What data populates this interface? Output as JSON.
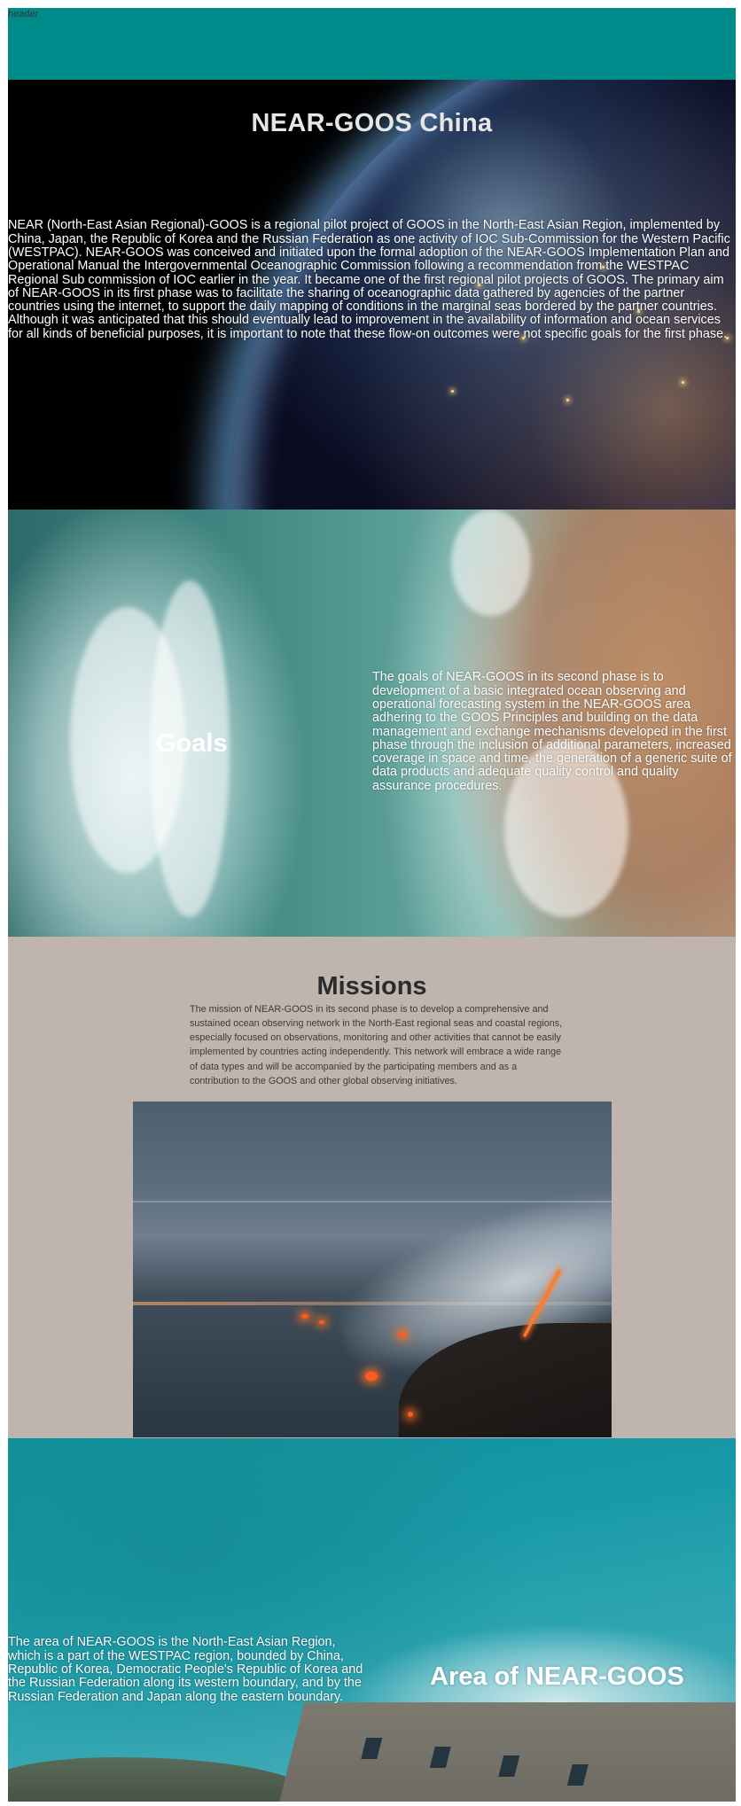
{
  "header": {
    "label": "header",
    "bar_color": "#008b8b"
  },
  "intro": {
    "title": "NEAR-GOOS China",
    "text": "NEAR (North-East Asian Regional)-GOOS is a regional pilot project of GOOS in the North-East Asian Region, implemented by China, Japan, the Republic of Korea and the Russian Federation as one activity of IOC Sub-Commission for the Western Pacific (WESTPAC). NEAR-GOOS was conceived and initiated upon the formal adoption of the NEAR-GOOS Implementation Plan and Operational Manual the Intergovernmental Oceanographic Commission following a recommendation from the WESTPAC Regional Sub commission of IOC earlier in the year. It became one of the first regional pilot projects of GOOS. The primary aim of NEAR-GOOS in its first phase was to facilitate the sharing of oceanographic data gathered by agencies of the partner countries using the internet, to support the daily mapping of conditions in the marginal seas bordered by the partner countries. Although it was anticipated that this should eventually lead to improvement in the availability of information and ocean services for all kinds of beneficial purposes, it is important to note that these flow-on outcomes were not specific goals for the first phase."
  },
  "goals": {
    "title": "Goals",
    "text": "The goals of NEAR-GOOS in its second phase is to development of a basic integrated ocean observing and operational forecasting system in the NEAR-GOOS area adhering to the GOOS Principles and building on the data management and exchange mechanisms developed in the first phase through the inclusion of additional parameters, increased coverage in space and time, the generation of a generic suite of data products and adequate quality control and quality assurance procedures."
  },
  "missions": {
    "title": "Missions",
    "text": "The mission of NEAR-GOOS in its second phase is to develop a comprehensive and sustained ocean observing network in the North-East regional seas and coastal regions, especially focused on observations, monitoring and other activities that cannot be easily implemented by countries acting independently. This network will embrace a wide range of data types and will be accompanied by the participating members and as a contribution to the GOOS and other global observing initiatives.",
    "background_color": "#bfb5ae"
  },
  "area": {
    "title": "Area of NEAR-GOOS",
    "text": "The area of NEAR-GOOS is the North-East Asian Region, which is a part of the WESTPAC region, bounded by China, Republic of Korea, Democratic People's Republic of Korea and the Russian Federation along its western boundary, and by the Russian Federation and Japan along the eastern boundary."
  }
}
